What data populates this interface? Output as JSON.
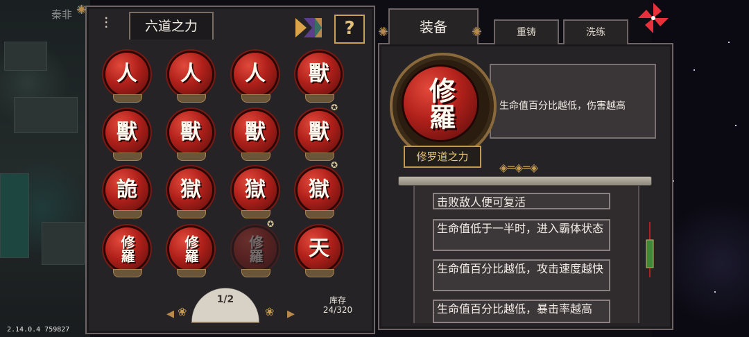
{
  "hud": {
    "player_name": "秦非",
    "version": "2.14.0.4 759827"
  },
  "left_panel": {
    "title": "六道之力",
    "help_label": "?",
    "orbs": [
      {
        "glyph": "人",
        "star": false,
        "dim": false
      },
      {
        "glyph": "人",
        "star": false,
        "dim": false
      },
      {
        "glyph": "人",
        "star": false,
        "dim": false
      },
      {
        "glyph": "獸",
        "star": false,
        "dim": false
      },
      {
        "glyph": "獸",
        "star": false,
        "dim": false
      },
      {
        "glyph": "獸",
        "star": false,
        "dim": false
      },
      {
        "glyph": "獸",
        "star": false,
        "dim": false
      },
      {
        "glyph": "獸",
        "star": true,
        "dim": false
      },
      {
        "glyph": "詭",
        "star": false,
        "dim": false
      },
      {
        "glyph": "獄",
        "star": false,
        "dim": false
      },
      {
        "glyph": "獄",
        "star": false,
        "dim": false
      },
      {
        "glyph": "獄",
        "star": true,
        "dim": false
      },
      {
        "glyph": "修羅",
        "star": false,
        "dim": false
      },
      {
        "glyph": "修羅",
        "star": false,
        "dim": false
      },
      {
        "glyph": "修羅",
        "star": true,
        "dim": true
      },
      {
        "glyph": "天",
        "star": false,
        "dim": false
      }
    ],
    "page": "1/2",
    "stock_label": "库存",
    "stock_value": "24/320"
  },
  "right_panel": {
    "tabs": {
      "equip": "装备",
      "recast": "重铸",
      "refine": "洗练"
    },
    "selected": {
      "glyph": "修羅",
      "name": "修罗道之力",
      "description": "生命值百分比越低，伤害越高"
    },
    "effects": [
      "击败敌人便可复活",
      "生命值低于一半时，进入霸体状态",
      "生命值百分比越低，攻击速度越快",
      "生命值百分比越低，暴击率越高"
    ]
  },
  "colors": {
    "accent_gold": "#c39a50",
    "orb_red": "#b0201a",
    "panel": "#262326"
  },
  "icons": [
    "tuning-icon",
    "sort-icon",
    "help-icon",
    "pinwheel-icon",
    "star-icon",
    "arrow-left-icon",
    "arrow-right-icon",
    "fan-icon",
    "tassel-icon"
  ]
}
